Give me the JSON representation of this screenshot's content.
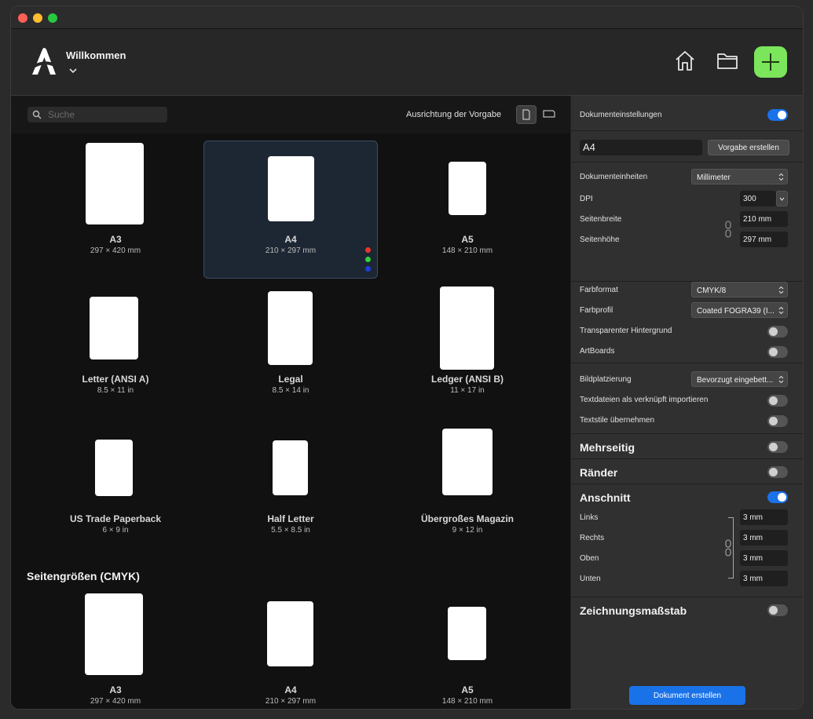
{
  "header": {
    "title": "Willkommen"
  },
  "toolbar": {
    "search_placeholder": "Suche",
    "orientation_label": "Ausrichtung der Vorgabe"
  },
  "presets": [
    {
      "name": "A3",
      "size": "297 × 420 mm"
    },
    {
      "name": "A4",
      "size": "210 × 297 mm"
    },
    {
      "name": "A5",
      "size": "148 × 210 mm"
    },
    {
      "name": "Letter (ANSI A)",
      "size": "8.5 × 11 in"
    },
    {
      "name": "Legal",
      "size": "8.5 × 14 in"
    },
    {
      "name": "Ledger (ANSI B)",
      "size": "11 × 17 in"
    },
    {
      "name": "US Trade Paperback",
      "size": "6 × 9 in"
    },
    {
      "name": "Half Letter",
      "size": "5.5 × 8.5 in"
    },
    {
      "name": "Übergroßes Magazin",
      "size": "9 × 12 in"
    }
  ],
  "cmyk_section": {
    "title": "Seitengrößen (CMYK)",
    "presets": [
      {
        "name": "A3",
        "size": "297 × 420 mm"
      },
      {
        "name": "A4",
        "size": "210 × 297 mm"
      },
      {
        "name": "A5",
        "size": "148 × 210 mm"
      }
    ]
  },
  "colors": {
    "accent": "#1a72e8",
    "create_button": "#7be55b",
    "dot_red": "#e8352b",
    "dot_green": "#2ed13a",
    "dot_blue": "#1d3ee0"
  },
  "settings": {
    "doc_settings_label": "Dokumenteinstellungen",
    "preset_name": "A4",
    "create_preset_button": "Vorgabe erstellen",
    "units_label": "Dokumenteinheiten",
    "units_value": "Millimeter",
    "dpi_label": "DPI",
    "dpi_value": "300",
    "width_label": "Seitenbreite",
    "width_value": "210 mm",
    "height_label": "Seitenhöhe",
    "height_value": "297 mm",
    "color_format_label": "Farbformat",
    "color_format_value": "CMYK/8",
    "color_profile_label": "Farbprofil",
    "color_profile_value": "Coated FOGRA39 (I...",
    "transparent_label": "Transparenter Hintergrund",
    "artboards_label": "ArtBoards",
    "image_placement_label": "Bildplatzierung",
    "image_placement_value": "Bevorzugt eingebett...",
    "import_text_label": "Textdateien als verknüpft importieren",
    "text_styles_label": "Textstile übernehmen",
    "multipage_label": "Mehrseitig",
    "margins_label": "Ränder",
    "bleed_label": "Anschnitt",
    "bleed_left_label": "Links",
    "bleed_left_value": "3 mm",
    "bleed_right_label": "Rechts",
    "bleed_right_value": "3 mm",
    "bleed_top_label": "Oben",
    "bleed_top_value": "3 mm",
    "bleed_bottom_label": "Unten",
    "bleed_bottom_value": "3 mm",
    "scale_label": "Zeichnungsmaßstab",
    "create_document_button": "Dokument erstellen"
  }
}
